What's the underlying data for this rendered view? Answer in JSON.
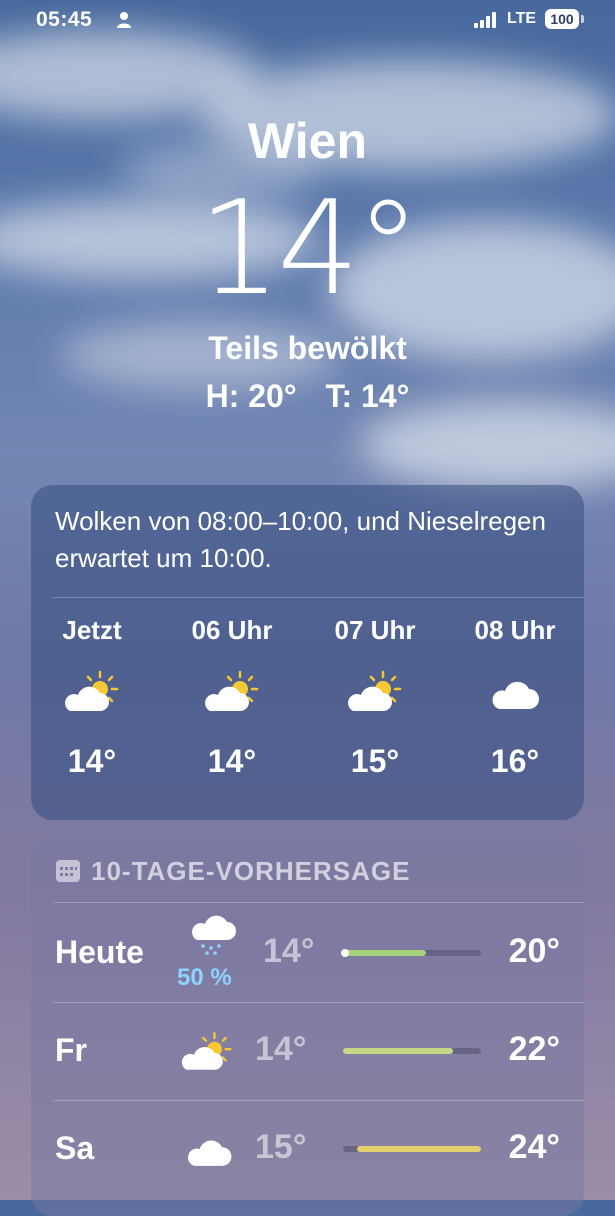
{
  "status_bar": {
    "time": "05:45",
    "network": "LTE",
    "battery": "100"
  },
  "location": {
    "city": "Wien",
    "temperature": "14°",
    "condition": "Teils bewölkt",
    "high": "H: 20°",
    "low": "T: 14°"
  },
  "hourly_card": {
    "summary": "Wolken von 08:00–10:00, und Nieselregen erwartet um 10:00.",
    "hours": [
      {
        "label": "Jetzt",
        "icon": "partly-cloudy-icon",
        "temp": "14°"
      },
      {
        "label": "06 Uhr",
        "icon": "partly-cloudy-icon",
        "temp": "14°"
      },
      {
        "label": "07 Uhr",
        "icon": "partly-cloudy-icon",
        "temp": "15°"
      },
      {
        "label": "08 Uhr",
        "icon": "cloud-icon",
        "temp": "16°"
      }
    ]
  },
  "daily_card": {
    "header": "10-TAGE-VORHERSAGE",
    "range_min": 14,
    "range_max": 24,
    "days": [
      {
        "day": "Heute",
        "icon": "drizzle-icon",
        "precip": "50 %",
        "low": "14°",
        "high": "20°",
        "low_value": 14,
        "high_value": 20,
        "fill_color": "#a7d07a",
        "current_value": 14
      },
      {
        "day": "Fr",
        "icon": "partly-cloudy-icon",
        "precip": "",
        "low": "14°",
        "high": "22°",
        "low_value": 14,
        "high_value": 22,
        "fill_color": "#c6d887",
        "current_value": null
      },
      {
        "day": "Sa",
        "icon": "cloud-icon",
        "precip": "",
        "low": "15°",
        "high": "24°",
        "low_value": 15,
        "high_value": 24,
        "fill_color": "#e0cf6b",
        "current_value": null
      }
    ]
  },
  "colors": {
    "sun": "#f6c833",
    "precip_text": "#8dd3ff"
  }
}
